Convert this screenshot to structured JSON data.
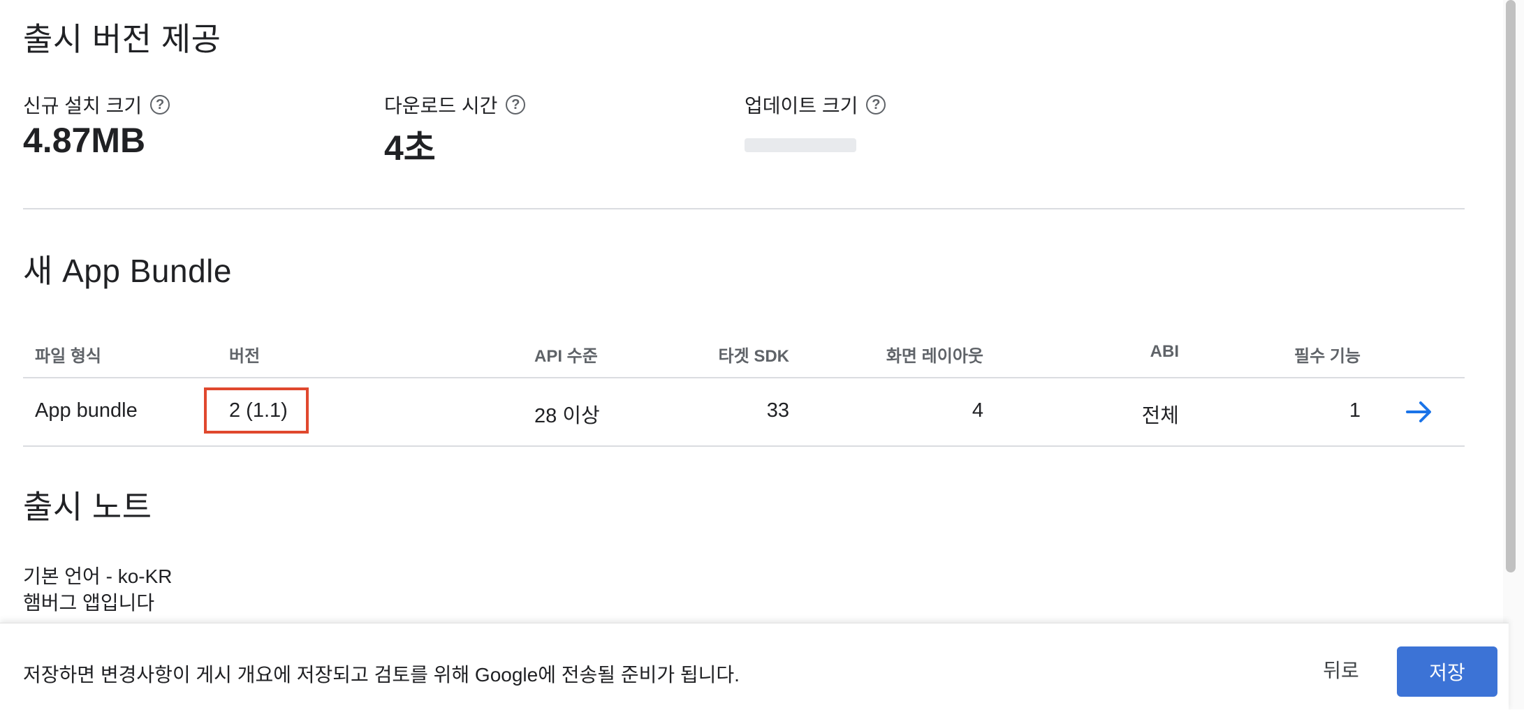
{
  "release": {
    "title": "출시 버전 제공",
    "metrics": [
      {
        "label": "신규 설치 크기",
        "value": "4.87MB"
      },
      {
        "label": "다운로드 시간",
        "value": "4초"
      },
      {
        "label": "업데이트 크기",
        "value": ""
      }
    ]
  },
  "bundle": {
    "title": "새 App Bundle",
    "headers": [
      "파일 형식",
      "버전",
      "API 수준",
      "타겟 SDK",
      "화면 레이아웃",
      "ABI",
      "필수 기능"
    ],
    "row": [
      "App bundle",
      "2 (1.1)",
      "28 이상",
      "33",
      "4",
      "전체",
      "1"
    ]
  },
  "notes": {
    "title": "출시 노트",
    "lines": [
      "기본 언어 - ko-KR",
      "햄버그 앱입니다"
    ]
  },
  "footer": {
    "message": "저장하면 변경사항이 게시 개요에 저장되고 검토를 위해 Google에 전송될 준비가 됩니다.",
    "back_label": "뒤로",
    "save_label": "저장"
  },
  "colors": {
    "accent": "#3c73d6",
    "highlight": "#e0482e"
  }
}
